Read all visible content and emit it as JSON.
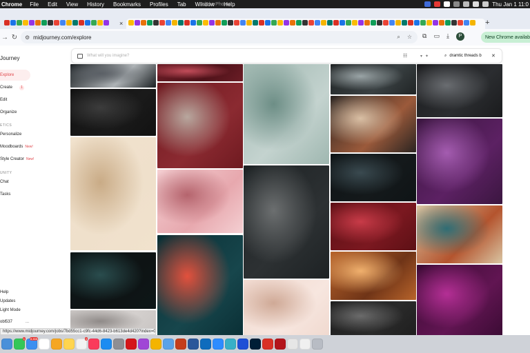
{
  "menubar": {
    "app_name": "Chrome",
    "items": [
      "File",
      "Edit",
      "View",
      "History",
      "Bookmarks",
      "Profiles",
      "Tab",
      "Window",
      "Help"
    ],
    "center_title": "Adobe Photosh",
    "clock": "Thu Jan 1  11:0"
  },
  "tabs": {
    "new_tab_symbol": "+",
    "close_symbol": "×",
    "favicon_colors": [
      "#d93025",
      "#1a73e8",
      "#34a853",
      "#fbbc05",
      "#9334e6",
      "#e8710a",
      "#0f9d58",
      "#333333",
      "#ea4335",
      "#4285f4",
      "#f4b400",
      "#00796b"
    ]
  },
  "toolbar": {
    "url": "midjourney.com/explore",
    "new_chrome_label": "New Chrome available"
  },
  "sidebar": {
    "brand": "Journey",
    "items": [
      {
        "label": "Explore",
        "active": true
      },
      {
        "label": "Create",
        "badge": "1"
      },
      {
        "label": "Edit"
      },
      {
        "label": "Organize"
      }
    ],
    "section1": "ETICS",
    "items2": [
      {
        "label": "Personalize"
      },
      {
        "label": "Moodboards",
        "tag": "New!"
      },
      {
        "label": "Style Creator",
        "tag": "New!"
      }
    ],
    "section2": "UNITY",
    "items3": [
      {
        "label": "Chat"
      },
      {
        "label": "Tasks"
      }
    ],
    "bottom_items": [
      "Help",
      "Updates",
      "Light Mode"
    ],
    "user": "obl537",
    "user_more": "..."
  },
  "search": {
    "placeholder": "What will you imagine?",
    "query": "dramtic threads b",
    "clear_symbol": "✕"
  },
  "status_url": "https://www.midjourney.com/jobs/7bd55cc1-c9fc-44d6-8423-b613de4d420?index=0",
  "gallery": {
    "tiles": [
      {
        "name": "figure-in-dark-room",
        "colors": [
          "#1b2023",
          "#5b6066",
          "#aeb3b6"
        ]
      },
      {
        "name": "charcoal-fabric-folds",
        "colors": [
          "#121212",
          "#3c3c3c",
          "#1a1a1a"
        ]
      },
      {
        "name": "cream-silk-with-pearls",
        "colors": [
          "#f1e2cd",
          "#c9ab86",
          "#efe0cb"
        ]
      },
      {
        "name": "dark-figure-teal-drape",
        "colors": [
          "#0d1718",
          "#2a4d4e",
          "#0e1314"
        ]
      },
      {
        "name": "grey-fabric-close-up",
        "colors": [
          "#c7c3c1",
          "#8f8a88",
          "#d4d0ce"
        ]
      },
      {
        "name": "red-silk-banner",
        "colors": [
          "#6b1d26",
          "#c14c59",
          "#4e1219"
        ]
      },
      {
        "name": "red-and-grey-draped-cloth",
        "colors": [
          "#6f1a20",
          "#b8a79e",
          "#8b2a31"
        ]
      },
      {
        "name": "pink-winter-landscape-collage",
        "colors": [
          "#f4cfd2",
          "#b5646d",
          "#e7a8ae"
        ]
      },
      {
        "name": "neon-portrait-red-teal",
        "colors": [
          "#0a2f35",
          "#e2513d",
          "#17464c"
        ]
      },
      {
        "name": "woman-profile-sage",
        "colors": [
          "#9fb7b0",
          "#6d8e86",
          "#c4d3cf"
        ]
      },
      {
        "name": "stage-curtain-drapery",
        "colors": [
          "#1d2224",
          "#6c6f70",
          "#2d3133"
        ]
      },
      {
        "name": "soft-peach-fabric",
        "colors": [
          "#f0d9cf",
          "#cfa996",
          "#f7e6df"
        ]
      },
      {
        "name": "silver-fabric-waves",
        "colors": [
          "#202425",
          "#9aa4a6",
          "#3a4143"
        ]
      },
      {
        "name": "floral-silk-scarf",
        "colors": [
          "#2a2421",
          "#d9bfa4",
          "#9b5a3b"
        ]
      },
      {
        "name": "dark-slate-silk",
        "colors": [
          "#0f1416",
          "#3a4a50",
          "#14191b"
        ]
      },
      {
        "name": "crimson-satin",
        "colors": [
          "#5d1015",
          "#c83b48",
          "#7b1820"
        ]
      },
      {
        "name": "gold-silk-waves",
        "colors": [
          "#b8642b",
          "#f0b06d",
          "#6f3417"
        ]
      },
      {
        "name": "dark-grey-drape",
        "colors": [
          "#1e1e1e",
          "#6b6b6b",
          "#2a2a2a"
        ]
      },
      {
        "name": "black-velvet-texture",
        "colors": [
          "#1a1b1d",
          "#6a6d71",
          "#2b2d30"
        ]
      },
      {
        "name": "purple-silk-swirls",
        "colors": [
          "#3b1640",
          "#a45cb0",
          "#5c2163"
        ]
      },
      {
        "name": "woman-patterned-robe",
        "colors": [
          "#d9c5a3",
          "#2f6d74",
          "#b4542e"
        ]
      },
      {
        "name": "magenta-orbs",
        "colors": [
          "#3a0b33",
          "#b42f95",
          "#611552"
        ]
      }
    ]
  },
  "dock": {
    "icons": [
      {
        "name": "finder-icon",
        "color": "#4a90d9"
      },
      {
        "name": "messages-icon",
        "color": "#34c759",
        "badge": "1"
      },
      {
        "name": "mail-icon",
        "color": "#3b8ff0",
        "badge": "8,468"
      },
      {
        "name": "calendar-icon",
        "color": "#ffffff"
      },
      {
        "name": "photos-icon",
        "color": "#f5a623"
      },
      {
        "name": "notes-icon",
        "color": "#ffd54f"
      },
      {
        "name": "reminders-icon",
        "color": "#f2f2f2",
        "badge": "4"
      },
      {
        "name": "music-icon",
        "color": "#fa3b5b"
      },
      {
        "name": "app-store-icon",
        "color": "#1c8cf1"
      },
      {
        "name": "system-settings-icon",
        "color": "#8e8e93"
      },
      {
        "name": "acrobat-icon",
        "color": "#d4161a"
      },
      {
        "name": "podcasts-icon",
        "color": "#a046d6"
      },
      {
        "name": "chrome-icon",
        "color": "#f4b400"
      },
      {
        "name": "preview-icon",
        "color": "#5aa2e8"
      },
      {
        "name": "powerpoint-icon",
        "color": "#c43e1c"
      },
      {
        "name": "word-icon",
        "color": "#2b579a"
      },
      {
        "name": "outlook-icon",
        "color": "#0f6cbd"
      },
      {
        "name": "zoom-icon",
        "color": "#2d8cff"
      },
      {
        "name": "claude-icon",
        "color": "#38b0c7"
      },
      {
        "name": "vpn-icon",
        "color": "#1e4fd6"
      },
      {
        "name": "photoshop-icon",
        "color": "#001e36"
      },
      {
        "name": "pdf-viewer-icon",
        "color": "#d93025"
      },
      {
        "name": "acrobat-reader-icon",
        "color": "#b3141b"
      },
      {
        "name": "document-icon",
        "color": "#e6e6e6"
      },
      {
        "name": "file-icon",
        "color": "#f0f0f0"
      },
      {
        "name": "trash-icon",
        "color": "#b8bcc4"
      }
    ]
  }
}
